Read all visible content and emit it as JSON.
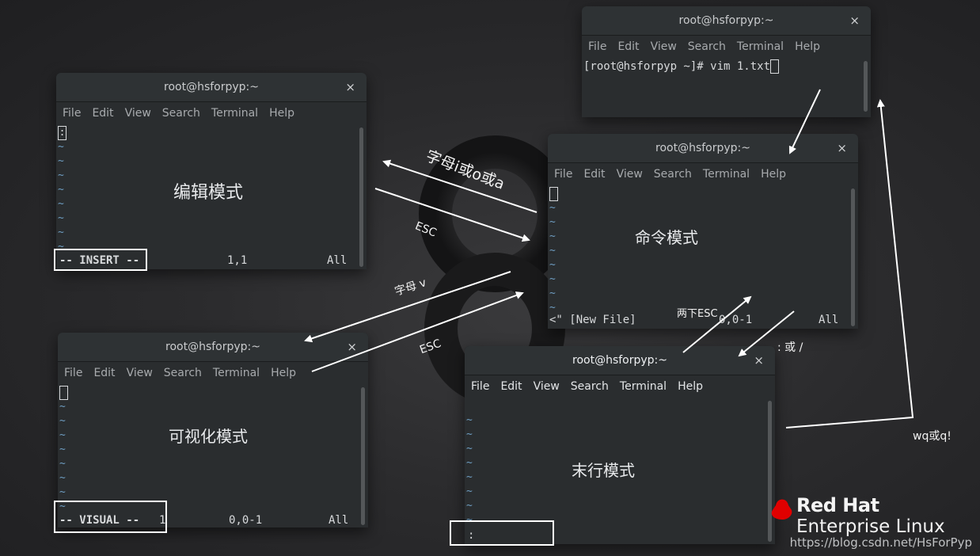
{
  "windows": {
    "command_top": {
      "title": "root@hsforpyp:~",
      "menu": [
        "File",
        "Edit",
        "View",
        "Search",
        "Terminal",
        "Help"
      ],
      "prompt": "[root@hsforpyp ~]# vim 1.txt"
    },
    "insert": {
      "title": "root@hsforpyp:~",
      "menu": [
        "File",
        "Edit",
        "View",
        "Search",
        "Terminal",
        "Help"
      ],
      "first_line": ":",
      "mode_label": "编辑模式",
      "status_mode": "-- INSERT --",
      "status_pos": "1,1",
      "status_scope": "All"
    },
    "command": {
      "title": "root@hsforpyp:~",
      "menu": [
        "File",
        "Edit",
        "View",
        "Search",
        "Terminal",
        "Help"
      ],
      "mode_label": "命令模式",
      "status_file": "<\" [New File]",
      "status_pos": "0,0-1",
      "status_scope": "All"
    },
    "visual": {
      "title": "root@hsforpyp:~",
      "menu": [
        "File",
        "Edit",
        "View",
        "Search",
        "Terminal",
        "Help"
      ],
      "mode_label": "可视化模式",
      "status_mode": "-- VISUAL --",
      "status_count": "1",
      "status_pos": "0,0-1",
      "status_scope": "All"
    },
    "lastline": {
      "title": "root@hsforpyp:~",
      "menu": [
        "File",
        "Edit",
        "View",
        "Search",
        "Terminal",
        "Help"
      ],
      "mode_label": "末行模式",
      "prompt": ":"
    }
  },
  "tilde": "~",
  "close_glyph": "×",
  "arrow_labels": {
    "to_insert": "字母i或o或a",
    "insert_esc": "ESC",
    "to_visual": "字母 v",
    "visual_esc": "ESC",
    "lastline_esc": "两下ESC",
    "to_lastline": ": 或 /",
    "quit": "wq或q!"
  },
  "brand": {
    "line1": "Red Hat",
    "line2": "Enterprise Linux"
  },
  "watermark": "https://blog.csdn.net/HsForPyp",
  "colors": {
    "tilde": "#6f9fc4",
    "highlight_box": "#ffffff",
    "redhat_red": "#e00000"
  }
}
